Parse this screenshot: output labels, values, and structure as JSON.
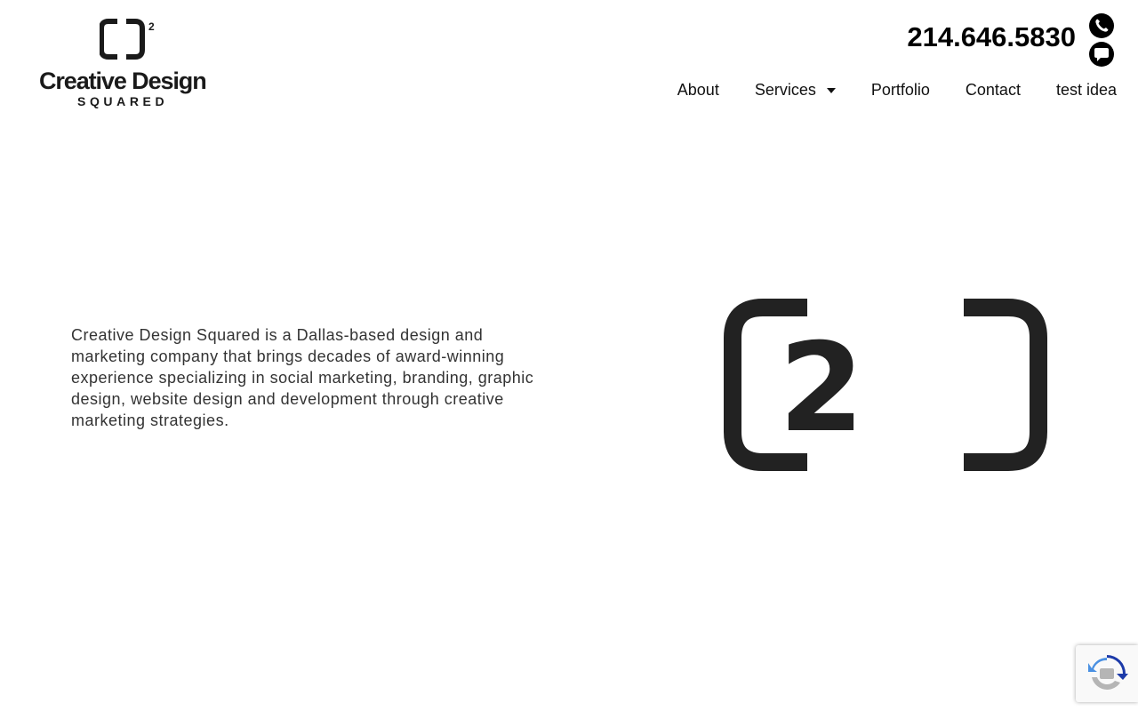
{
  "header": {
    "logo": {
      "name": "Creative Design",
      "sub": "SQUARED",
      "superscript": "2"
    },
    "phone": "214.646.5830",
    "icons": [
      "phone-icon",
      "chat-icon"
    ]
  },
  "nav": {
    "items": [
      {
        "label": "About"
      },
      {
        "label": "Services",
        "has_dropdown": true
      },
      {
        "label": "Portfolio"
      },
      {
        "label": "Contact"
      },
      {
        "label": "test idea"
      }
    ]
  },
  "main": {
    "intro": "Creative Design Squared is a Dallas-based design and marketing company that brings decades of award-winning experience specializing in social marketing, branding, graphic design, website design and development through creative marketing strategies.",
    "mark_digit": "2"
  },
  "colors": {
    "text": "#000000",
    "body_text": "#333333",
    "mark": "#222222",
    "recaptcha_blue": "#4a90e2",
    "recaptcha_gray": "#b5b5b5"
  }
}
